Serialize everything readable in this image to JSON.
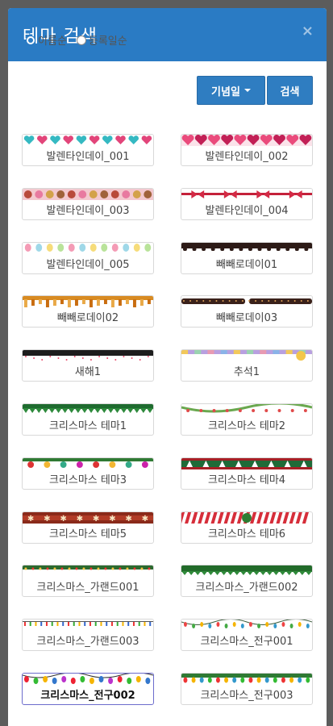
{
  "modal": {
    "title": "테마 검색",
    "close": "×"
  },
  "sort": [
    {
      "label": "이름순",
      "checked": true
    },
    {
      "label": "등록일순",
      "checked": false
    }
  ],
  "buttons": {
    "category": "기념일",
    "search": "검색"
  },
  "themes": [
    {
      "label": "발렌타인데이_001",
      "pattern": "hearts-teal"
    },
    {
      "label": "발렌타인데이_002",
      "pattern": "hearts-pink"
    },
    {
      "label": "발렌타인데이_003",
      "pattern": "candies"
    },
    {
      "label": "발렌타인데이_004",
      "pattern": "ribbon-red"
    },
    {
      "label": "발렌타인데이_005",
      "pattern": "balloons"
    },
    {
      "label": "빼빼로데이01",
      "pattern": "chocolate-drip"
    },
    {
      "label": "빼빼로데이02",
      "pattern": "sticks"
    },
    {
      "label": "빼빼로데이03",
      "pattern": "chocolate-bar"
    },
    {
      "label": "새해1",
      "pattern": "newyear"
    },
    {
      "label": "추석1",
      "pattern": "chuseok"
    },
    {
      "label": "크리스마스 테마1",
      "pattern": "pine"
    },
    {
      "label": "크리스마스 테마2",
      "pattern": "garland-light"
    },
    {
      "label": "크리스마스 테마3",
      "pattern": "ornaments"
    },
    {
      "label": "크리스마스 테마4",
      "pattern": "trees-red"
    },
    {
      "label": "크리스마스 테마5",
      "pattern": "stars-brown"
    },
    {
      "label": "크리스마스 테마6",
      "pattern": "candy-cane"
    },
    {
      "label": "크리스마스_가랜드001",
      "pattern": "garland-dots"
    },
    {
      "label": "크리스마스_가랜드002",
      "pattern": "garland-green"
    },
    {
      "label": "크리스마스_가랜드003",
      "pattern": "lights-thin"
    },
    {
      "label": "크리스마스_전구001",
      "pattern": "bulbs-string"
    },
    {
      "label": "크리스마스_전구002",
      "pattern": "bulbs-color",
      "selected": true
    },
    {
      "label": "크리스마스_전구003",
      "pattern": "bulbs-green"
    }
  ]
}
